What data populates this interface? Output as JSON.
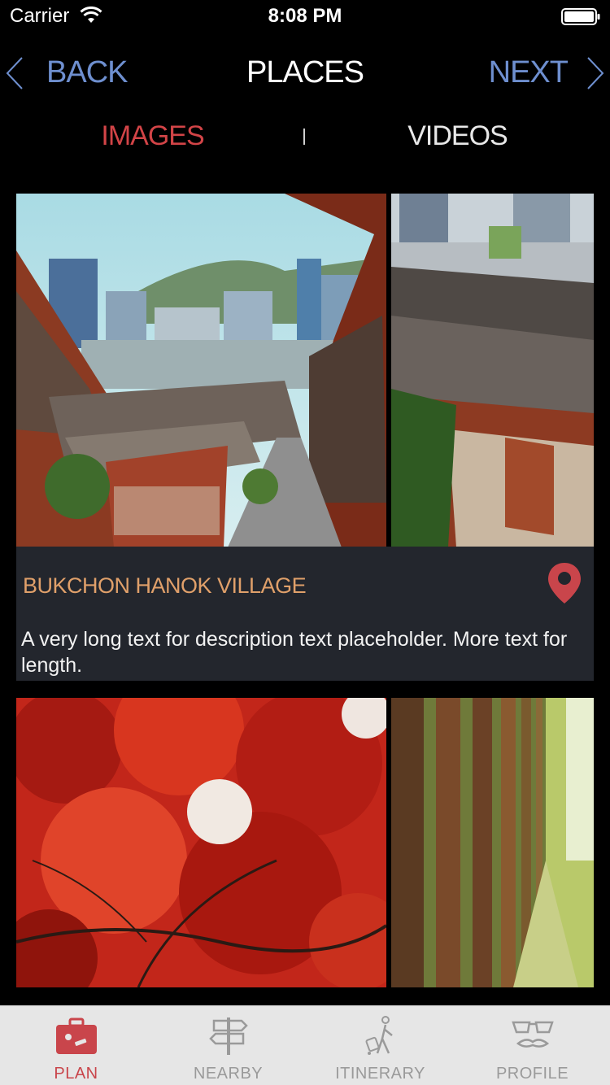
{
  "status_bar": {
    "carrier": "Carrier",
    "time": "8:08 PM",
    "icons": [
      "wifi-icon",
      "battery-icon"
    ]
  },
  "nav": {
    "back_label": "BACK",
    "title": "PLACES",
    "next_label": "NEXT",
    "link_color": "#6e8fcf"
  },
  "segments": {
    "images_label": "IMAGES",
    "videos_label": "VIDEOS",
    "selected": "IMAGES",
    "selected_color": "#d24447"
  },
  "places": [
    {
      "name": "BUKCHON HANOK VILLAGE",
      "description": "A very long text for description text placeholder. More text for length.",
      "name_color": "#e0a06a",
      "photos": [
        "hanok-alley-city-view",
        "hanok-rooftops"
      ]
    },
    {
      "photos": [
        "red-maple-tree",
        "tree-lined-path"
      ]
    }
  ],
  "tab_bar": {
    "items": [
      {
        "label": "PLAN",
        "icon": "briefcase-icon",
        "active": true
      },
      {
        "label": "NEARBY",
        "icon": "signpost-icon",
        "active": false
      },
      {
        "label": "ITINERARY",
        "icon": "traveler-icon",
        "active": false
      },
      {
        "label": "PROFILE",
        "icon": "glasses-mustache-icon",
        "active": false
      }
    ],
    "active_color": "#c9454b"
  }
}
